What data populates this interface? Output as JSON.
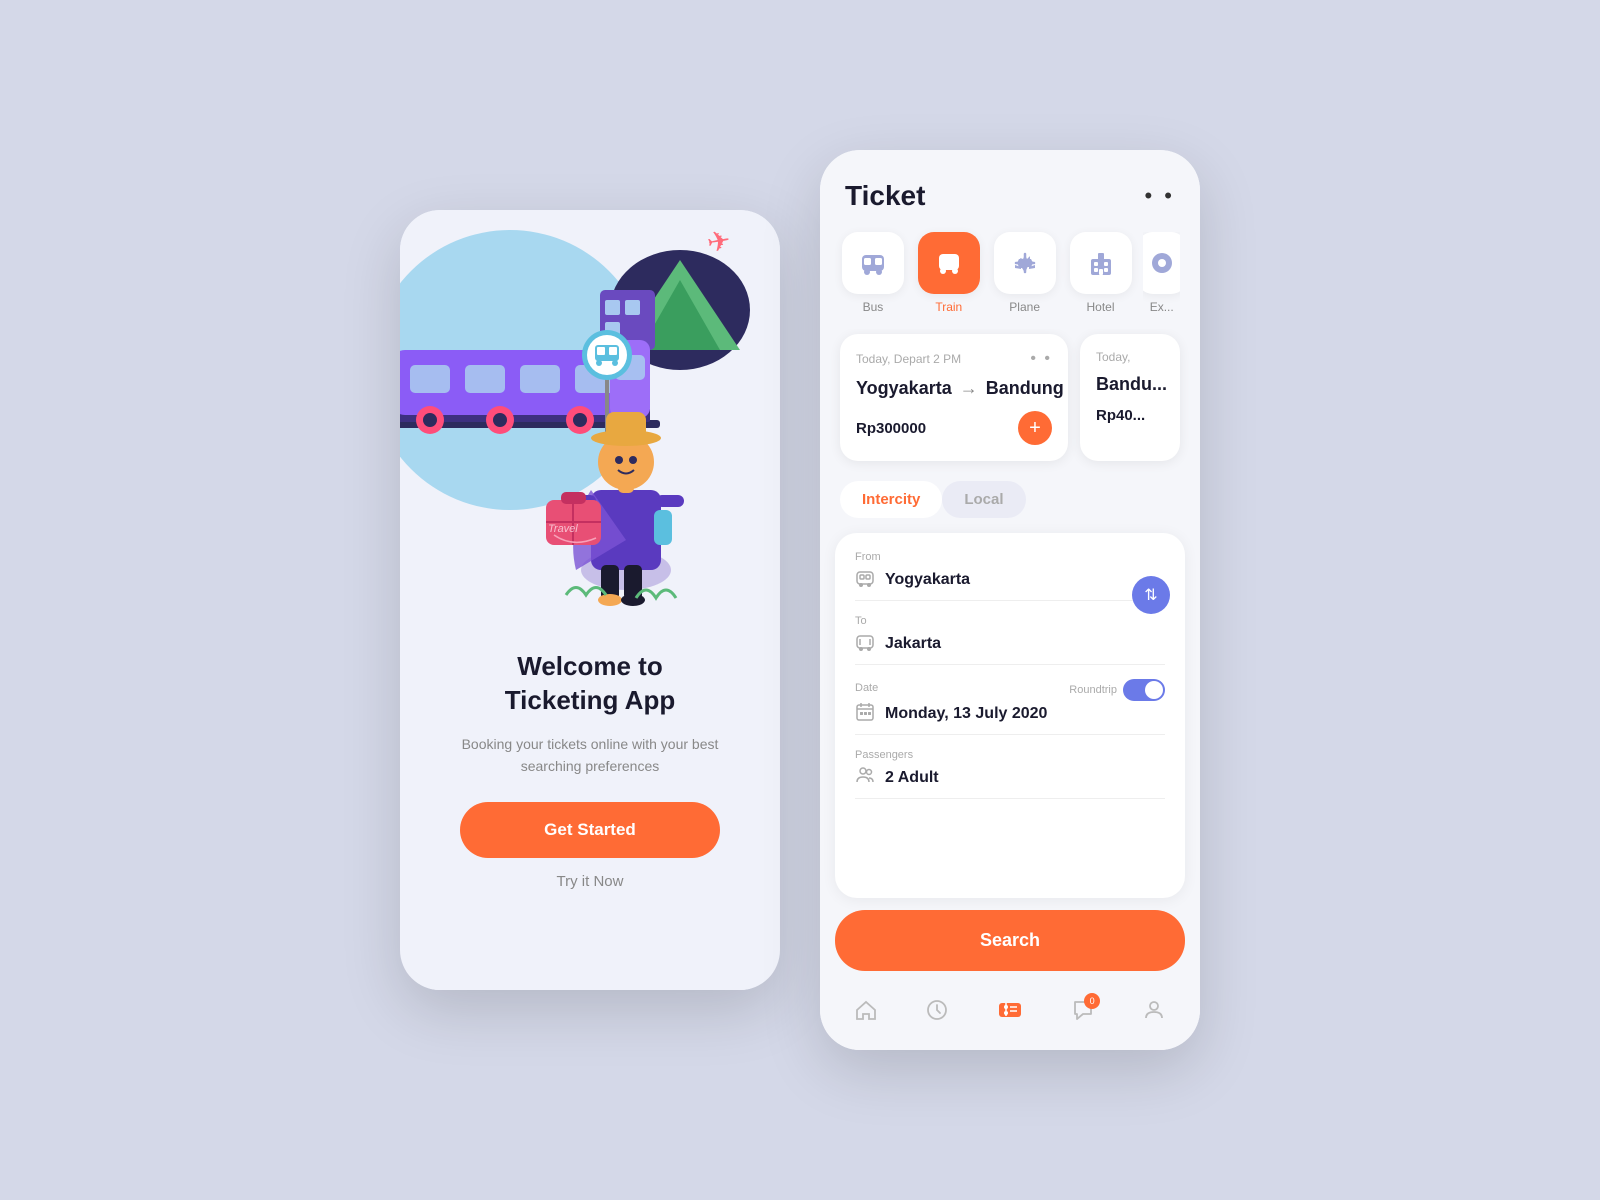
{
  "leftPhone": {
    "welcomeTitle": "Welcome to\nTicketing App",
    "subtitle": "Booking your tickets online with your best searching preferences",
    "getStartedLabel": "Get Started",
    "tryNowLabel": "Try it Now"
  },
  "rightPhone": {
    "header": {
      "title": "Ticket",
      "dotsLabel": "• •"
    },
    "categories": [
      {
        "id": "bus",
        "label": "Bus",
        "active": false
      },
      {
        "id": "train",
        "label": "Train",
        "active": true
      },
      {
        "id": "plane",
        "label": "Plane",
        "active": false
      },
      {
        "id": "hotel",
        "label": "Hotel",
        "active": false
      },
      {
        "id": "extra",
        "label": "Ex...",
        "active": false
      }
    ],
    "bookingCards": [
      {
        "date": "Today, Depart 2 PM",
        "from": "Yogyakarta",
        "to": "Bandung",
        "price": "Rp300000"
      },
      {
        "date": "Today,",
        "from": "Bandu...",
        "to": "",
        "price": "Rp40..."
      }
    ],
    "tabs": [
      {
        "label": "Intercity",
        "active": true
      },
      {
        "label": "Local",
        "active": false
      }
    ],
    "form": {
      "fromLabel": "From",
      "fromValue": "Yogyakarta",
      "toLabel": "To",
      "toValue": "Jakarta",
      "dateLabel": "Date",
      "dateValue": "Monday, 13 July 2020",
      "roundtripLabel": "Roundtrip",
      "passengersLabel": "Passengers",
      "passengersValue": "2 Adult"
    },
    "searchLabel": "Search",
    "bottomNav": [
      {
        "id": "home",
        "label": "home"
      },
      {
        "id": "history",
        "label": "history"
      },
      {
        "id": "ticket",
        "label": "ticket",
        "active": true,
        "badge": null
      },
      {
        "id": "chat",
        "label": "chat",
        "badge": "0"
      },
      {
        "id": "profile",
        "label": "profile"
      }
    ]
  },
  "colors": {
    "primary": "#ff6b35",
    "accent": "#6b7ae8",
    "background": "#d4d8e8"
  }
}
